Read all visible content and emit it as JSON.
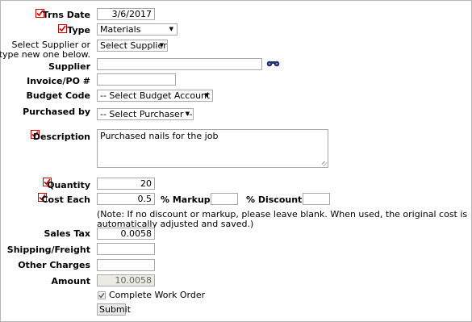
{
  "form": {
    "trns_date": {
      "label": "Trns Date",
      "value": "3/6/2017"
    },
    "type": {
      "label": "Type",
      "selected": "Materials"
    },
    "supplier_hint": {
      "line1": "Select Supplier or",
      "line2": "type new one below."
    },
    "select_supplier": {
      "selected": "Select Supplier"
    },
    "supplier": {
      "label": "Supplier",
      "value": ""
    },
    "invoice": {
      "label": "Invoice/PO #",
      "value": ""
    },
    "budget_code": {
      "label": "Budget Code",
      "selected": "-- Select Budget Account --"
    },
    "purchased_by": {
      "label": "Purchased by",
      "selected": "-- Select Purchaser --"
    },
    "description": {
      "label": "Description",
      "value": "Purchased nails for the job"
    },
    "quantity": {
      "label": "Quantity",
      "value": "20"
    },
    "cost_each": {
      "label": "Cost Each",
      "value": "0.5"
    },
    "markup": {
      "label": "% Markup",
      "value": ""
    },
    "discount": {
      "label": "% Discount",
      "value": ""
    },
    "note": "(Note: If no discount or markup, please leave blank. When used, the original cost is automatically adjusted and saved.)",
    "sales_tax": {
      "label": "Sales Tax",
      "value": "0.0058"
    },
    "shipping": {
      "label": "Shipping/Freight",
      "value": ""
    },
    "other_charges": {
      "label": "Other Charges",
      "value": ""
    },
    "amount": {
      "label": "Amount",
      "value": "10.0058"
    },
    "complete_work_order": {
      "label": "Complete Work Order",
      "checked": true
    },
    "submit_label": "Submit"
  },
  "icons": {
    "required": "red-checked-box",
    "lookup": "binoculars"
  },
  "colors": {
    "required_mark": "#cc0000",
    "border": "#a9a9a9",
    "readonly_bg": "#ebebe4"
  }
}
